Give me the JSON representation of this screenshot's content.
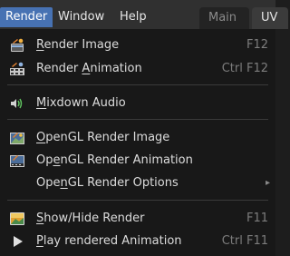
{
  "menubar": {
    "items": [
      {
        "label": "Render"
      },
      {
        "label": "Window"
      },
      {
        "label": "Help"
      }
    ],
    "workspace_tabs": [
      {
        "label": "Main"
      },
      {
        "label": "UV"
      }
    ]
  },
  "menu": {
    "items": [
      {
        "label_pre": "",
        "label_u": "R",
        "label_post": "ender Image",
        "shortcut": "F12",
        "icon": "render-still-icon"
      },
      {
        "label_pre": "Render ",
        "label_u": "A",
        "label_post": "nimation",
        "shortcut": "Ctrl F12",
        "icon": "render-animation-icon"
      },
      {
        "label_pre": "",
        "label_u": "M",
        "label_post": "ixdown Audio",
        "shortcut": "",
        "icon": "speaker-icon"
      },
      {
        "label_pre": "",
        "label_u": "O",
        "label_post": "penGL Render Image",
        "shortcut": "",
        "icon": "opengl-still-icon"
      },
      {
        "label_pre": "Op",
        "label_u": "e",
        "label_post": "nGL Render Animation",
        "shortcut": "",
        "icon": "opengl-animation-icon"
      },
      {
        "label_pre": "Ope",
        "label_u": "n",
        "label_post": "GL Render Options",
        "shortcut": "",
        "icon": ""
      },
      {
        "label_pre": "",
        "label_u": "S",
        "label_post": "how/Hide Render",
        "shortcut": "F11",
        "icon": "image-icon"
      },
      {
        "label_pre": "",
        "label_u": "P",
        "label_post": "lay rendered Animation",
        "shortcut": "Ctrl F11",
        "icon": "play-icon"
      }
    ],
    "submenu_arrow": "▸"
  }
}
